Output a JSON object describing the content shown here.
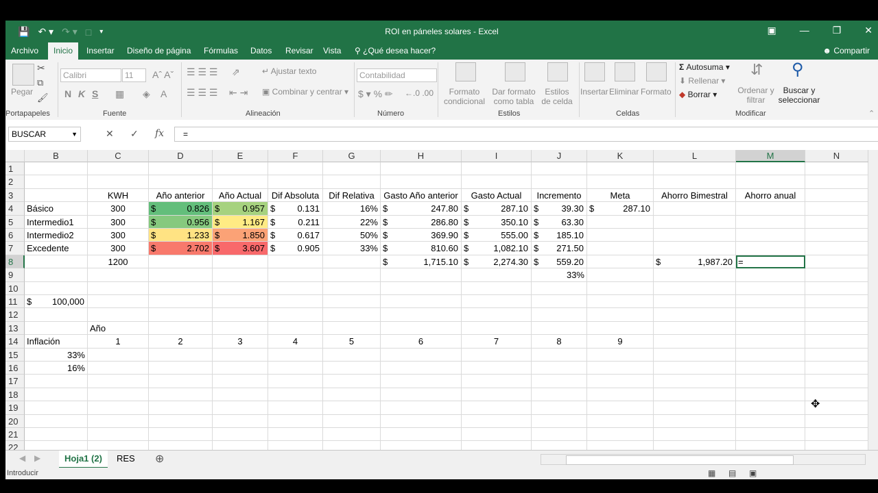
{
  "app": {
    "title": "ROI en páneles solares - Excel",
    "share": "Compartir",
    "menu": [
      "Archivo",
      "Inicio",
      "Insertar",
      "Diseño de página",
      "Fórmulas",
      "Datos",
      "Revisar",
      "Vista"
    ],
    "tellme": "¿Qué desea hacer?"
  },
  "ribbon": {
    "paste": "Pegar",
    "font_name": "Calibri",
    "font_size": "11",
    "bold": "N",
    "italic": "K",
    "underline": "S",
    "wrap": "Ajustar texto",
    "merge": "Combinar y centrar",
    "number_format": "Contabilidad",
    "cond_format": "Formato condicional",
    "format_table": "Dar formato como tabla",
    "cell_styles": "Estilos de celda",
    "insert": "Insertar",
    "delete": "Eliminar",
    "format": "Formato",
    "autosum": "Autosuma",
    "fill": "Rellenar",
    "clear": "Borrar",
    "sort": "Ordenar y filtrar",
    "find": "Buscar y seleccionar",
    "groups": {
      "clipboard": "Portapapeles",
      "font": "Fuente",
      "alignment": "Alineación",
      "number": "Número",
      "styles": "Estilos",
      "cells": "Celdas",
      "editing": "Modificar"
    }
  },
  "formula_bar": {
    "name_box": "BUSCAR",
    "formula": "="
  },
  "columns": [
    "B",
    "C",
    "D",
    "E",
    "F",
    "G",
    "H",
    "I",
    "J",
    "K",
    "L",
    "M",
    "N"
  ],
  "rows": [
    "1",
    "2",
    "3",
    "4",
    "5",
    "6",
    "7",
    "8",
    "9",
    "10",
    "11",
    "12",
    "13",
    "14",
    "15",
    "16",
    "17",
    "18",
    "19",
    "20",
    "21",
    "22"
  ],
  "cells": {
    "headers": {
      "C3": "KWH",
      "D3": "Año anterior",
      "E3": "Año Actual",
      "F3": "Dif Absoluta",
      "G3": "Dif Relativa",
      "H3": "Gasto Año anterior",
      "I3": "Gasto Actual",
      "J3": "Incremento",
      "K3": "Meta",
      "L3": "Ahorro Bimestral",
      "M3": "Ahorro anual"
    },
    "tiers": [
      {
        "name": "Básico",
        "kwh": "300",
        "prev": "0.826",
        "curr": "0.957",
        "abs": "0.131",
        "rel": "16%",
        "gprev": "247.80",
        "gcurr": "287.10",
        "inc": "39.30",
        "meta": "287.10"
      },
      {
        "name": "Intermedio1",
        "kwh": "300",
        "prev": "0.956",
        "curr": "1.167",
        "abs": "0.211",
        "rel": "22%",
        "gprev": "286.80",
        "gcurr": "350.10",
        "inc": "63.30",
        "meta": ""
      },
      {
        "name": "Intermedio2",
        "kwh": "300",
        "prev": "1.233",
        "curr": "1.850",
        "abs": "0.617",
        "rel": "50%",
        "gprev": "369.90",
        "gcurr": "555.00",
        "inc": "185.10",
        "meta": ""
      },
      {
        "name": "Excedente",
        "kwh": "300",
        "prev": "2.702",
        "curr": "3.607",
        "abs": "0.905",
        "rel": "33%",
        "gprev": "810.60",
        "gcurr": "1,082.10",
        "inc": "271.50",
        "meta": ""
      }
    ],
    "totals": {
      "kwh": "1200",
      "gprev": "1,715.10",
      "gcurr": "2,274.30",
      "inc": "559.20",
      "ahorro": "1,987.20",
      "m8": "="
    },
    "j9": "33%",
    "b11": "100,000",
    "c13": "Año",
    "b14": "Inflación",
    "years": [
      "1",
      "2",
      "3",
      "4",
      "5",
      "6",
      "7",
      "8",
      "9"
    ],
    "b15": "33%",
    "b16": "16%",
    "currency": "$"
  },
  "colors": {
    "accent": "#217346",
    "prev": [
      "#63be7b",
      "#86c97e",
      "#ffe383",
      "#f8796c"
    ],
    "curr": [
      "#a6d27f",
      "#ffeb84",
      "#fba276",
      "#f8696b"
    ]
  },
  "sheets": [
    "Hoja1 (2)",
    "RES"
  ],
  "status": "Introducir"
}
